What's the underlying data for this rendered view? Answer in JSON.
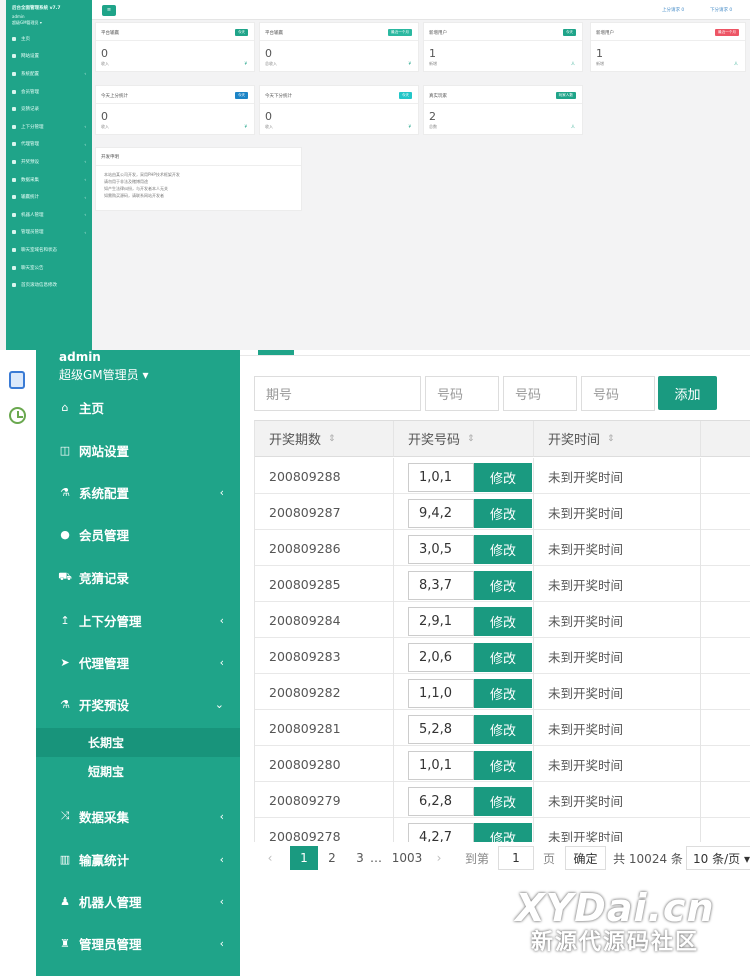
{
  "shotA": {
    "sidebar": {
      "title": "后台全面管理系统 v7.7",
      "user": "admin",
      "role": "超级GM管理员 ▾",
      "items": [
        {
          "label": "主页",
          "chevron": ""
        },
        {
          "label": "网站设置",
          "chevron": ""
        },
        {
          "label": "系统配置",
          "chevron": "‹"
        },
        {
          "label": "会员管理",
          "chevron": ""
        },
        {
          "label": "竞猜记录",
          "chevron": ""
        },
        {
          "label": "上下分管理",
          "chevron": "‹"
        },
        {
          "label": "代理管理",
          "chevron": "‹"
        },
        {
          "label": "开奖预设",
          "chevron": "‹"
        },
        {
          "label": "数据采集",
          "chevron": "‹"
        },
        {
          "label": "输赢统计",
          "chevron": "‹"
        },
        {
          "label": "机器人管理",
          "chevron": "‹"
        },
        {
          "label": "管理员管理",
          "chevron": "‹"
        },
        {
          "label": "聊天室域名和状态",
          "chevron": ""
        },
        {
          "label": "聊天室公告",
          "chevron": ""
        },
        {
          "label": "首页滚动信息修改",
          "chevron": ""
        }
      ]
    },
    "topbar": {
      "menu_button": "≡",
      "link_up": "上分请求 0",
      "link_down": "下分请求 0"
    },
    "cards": [
      {
        "title": "平台输赢",
        "badge": "今天",
        "badge_color": "#1fa489",
        "value": "0",
        "sub": "收入",
        "num": "¥"
      },
      {
        "title": "平台输赢",
        "badge": "最近一个月",
        "badge_color": "#2bb8a0",
        "value": "0",
        "sub": "总收入",
        "num": "¥"
      },
      {
        "title": "新增用户",
        "badge": "今天",
        "badge_color": "#1fa489",
        "value": "1",
        "sub": "新增",
        "num": "人"
      },
      {
        "title": "新增用户",
        "badge": "最近一个月",
        "badge_color": "#ed5565",
        "value": "1",
        "sub": "新增",
        "num": "人"
      },
      {
        "title": "今天上分统计",
        "badge": "今天",
        "badge_color": "#1c84c6",
        "value": "0",
        "sub": "收入",
        "num": "¥"
      },
      {
        "title": "今天下分统计",
        "badge": "今天",
        "badge_color": "#23c6c8",
        "value": "0",
        "sub": "收入",
        "num": "¥"
      },
      {
        "title": "真实玩家",
        "badge": "玩家人数",
        "badge_color": "#1fa489",
        "value": "2",
        "sub": "总数",
        "num": "人"
      }
    ],
    "notice": {
      "title": "开发申明",
      "lines": [
        "本站由某公司开发，采用PHP技术框架开发",
        "请勿用于非法及赌博用途",
        "如产生法律纠纷，与开发者本人无关",
        "如需购买源码，请联系网站开发者"
      ]
    }
  },
  "shotB": {
    "sidebar": {
      "admin": "admin",
      "role": "超级GM管理员 ▾",
      "items": [
        {
          "label": "主页",
          "icon": "home-icon",
          "glyph": "⌂",
          "chevron": ""
        },
        {
          "label": "网站设置",
          "icon": "columns-icon",
          "glyph": "◫",
          "chevron": ""
        },
        {
          "label": "系统配置",
          "icon": "flask-icon",
          "glyph": "⚗",
          "chevron": "‹"
        },
        {
          "label": "会员管理",
          "icon": "user-icon",
          "glyph": "●",
          "chevron": ""
        },
        {
          "label": "竞猜记录",
          "icon": "car-icon",
          "glyph": "⛟",
          "chevron": ""
        },
        {
          "label": "上下分管理",
          "icon": "level-up-icon",
          "glyph": "↥",
          "chevron": "‹"
        },
        {
          "label": "代理管理",
          "icon": "paper-plane-icon",
          "glyph": "➤",
          "chevron": "‹"
        },
        {
          "label": "开奖预设",
          "icon": "flask-icon",
          "glyph": "⚗",
          "chevron": "⌄"
        }
      ],
      "subitems": [
        "长期宝",
        "短期宝"
      ],
      "items2": [
        {
          "label": "数据采集",
          "icon": "random-icon",
          "glyph": "⤨",
          "chevron": "‹"
        },
        {
          "label": "输赢统计",
          "icon": "bar-chart-icon",
          "glyph": "▥",
          "chevron": "‹"
        },
        {
          "label": "机器人管理",
          "icon": "male-icon",
          "glyph": "♟",
          "chevron": "‹"
        },
        {
          "label": "管理员管理",
          "icon": "user-secret-icon",
          "glyph": "♜",
          "chevron": "‹"
        }
      ]
    },
    "form": {
      "period_placeholder": "期号",
      "code_placeholder": "号码",
      "add_label": "添加"
    },
    "table": {
      "headers": [
        "开奖期数",
        "开奖号码",
        "开奖时间"
      ],
      "sort_glyph": "⇕",
      "modify_label": "修改",
      "rows": [
        {
          "period": "200809288",
          "code": "1,0,1",
          "time": "未到开奖时间"
        },
        {
          "period": "200809287",
          "code": "9,4,2",
          "time": "未到开奖时间"
        },
        {
          "period": "200809286",
          "code": "3,0,5",
          "time": "未到开奖时间"
        },
        {
          "period": "200809285",
          "code": "8,3,7",
          "time": "未到开奖时间"
        },
        {
          "period": "200809284",
          "code": "2,9,1",
          "time": "未到开奖时间"
        },
        {
          "period": "200809283",
          "code": "2,0,6",
          "time": "未到开奖时间"
        },
        {
          "period": "200809282",
          "code": "1,1,0",
          "time": "未到开奖时间"
        },
        {
          "period": "200809281",
          "code": "5,2,8",
          "time": "未到开奖时间"
        },
        {
          "period": "200809280",
          "code": "1,0,1",
          "time": "未到开奖时间"
        },
        {
          "period": "200809279",
          "code": "6,2,8",
          "time": "未到开奖时间"
        },
        {
          "period": "200809278",
          "code": "4,2,7",
          "time": "未到开奖时间"
        }
      ]
    },
    "pager": {
      "prev": "‹",
      "pages": [
        "1",
        "2",
        "3"
      ],
      "ellipsis": "…",
      "last": "1003",
      "next": "›",
      "goto_label": "到第",
      "goto_value": "1",
      "page_unit": "页",
      "confirm": "确定",
      "total": "共 10024 条",
      "per_page": "10 条/页 ▾"
    }
  },
  "watermark": {
    "line1": "XYDai.cn",
    "line2": "新源代源码社区"
  }
}
